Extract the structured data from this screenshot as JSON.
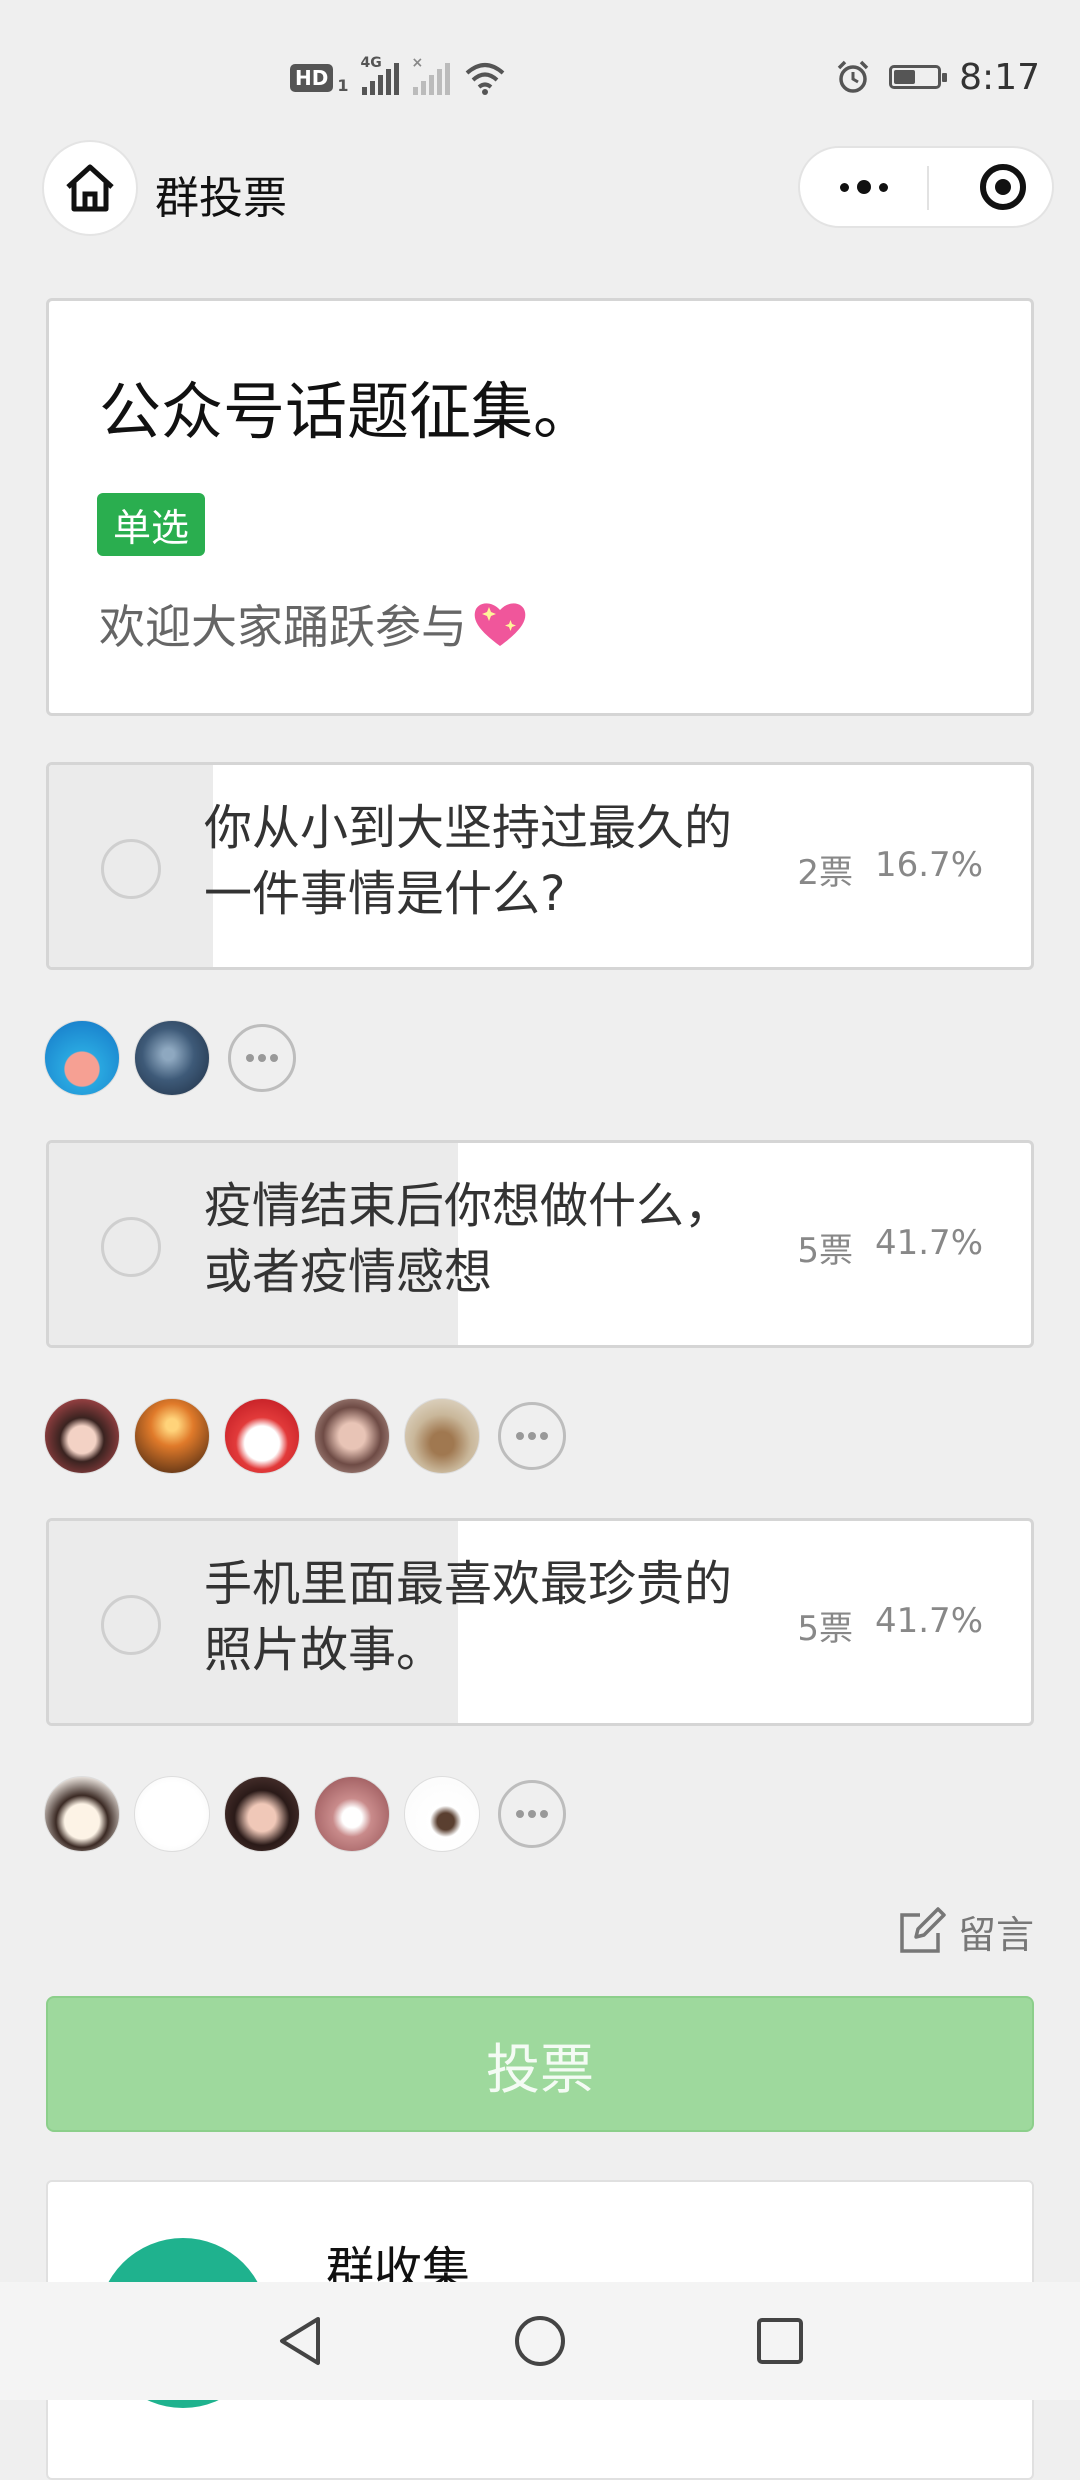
{
  "status_bar": {
    "hd": "HD",
    "sim": "1",
    "net": "4G",
    "time": "8:17",
    "battery_level": 0.5
  },
  "header": {
    "title": "群投票"
  },
  "poll": {
    "title": "公众号话题征集。",
    "type_tag": "单选",
    "description": "欢迎大家踊跃参与",
    "options": [
      {
        "line1": "你从小到大坚持过最久的",
        "line2": "一件事情是什么?",
        "votes": "2票",
        "percent": "16.7%",
        "share": 0.167
      },
      {
        "line1": "疫情结束后你想做什么，",
        "line2": "或者疫情感想",
        "votes": "5票",
        "percent": "41.7%",
        "share": 0.417
      },
      {
        "line1": "手机里面最喜欢最珍贵的",
        "line2": "照片故事。",
        "votes": "5票",
        "percent": "41.7%",
        "share": 0.417
      }
    ],
    "comment_label": "留言",
    "vote_button": "投票"
  },
  "group_card": {
    "name": "群收集"
  },
  "colors": {
    "accent_green": "#2aae4f",
    "vote_button": "#9ed99d",
    "group_logo": "#1fb28e"
  }
}
